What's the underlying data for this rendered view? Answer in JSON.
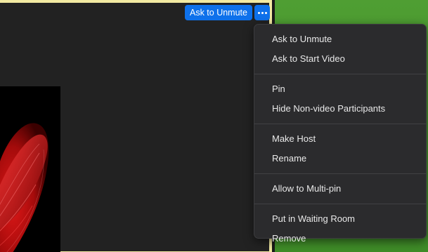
{
  "controls": {
    "ask_to_unmute_label": "Ask to Unmute",
    "more_icon": "ellipsis-icon"
  },
  "colors": {
    "accent": "#0e71eb",
    "active_speaker_border": "#f2eaa2",
    "side_tile": "#4a9a30",
    "menu_bg": "#2b2b2d"
  },
  "menu": {
    "groups": [
      {
        "items": [
          {
            "label": "Ask to Unmute"
          },
          {
            "label": "Ask to Start Video"
          }
        ]
      },
      {
        "items": [
          {
            "label": "Pin"
          },
          {
            "label": "Hide Non-video Participants"
          }
        ]
      },
      {
        "items": [
          {
            "label": "Make Host"
          },
          {
            "label": "Rename"
          }
        ]
      },
      {
        "items": [
          {
            "label": "Allow to Multi-pin"
          }
        ]
      },
      {
        "items": [
          {
            "label": "Put in Waiting Room"
          },
          {
            "label": "Remove"
          }
        ]
      }
    ]
  }
}
